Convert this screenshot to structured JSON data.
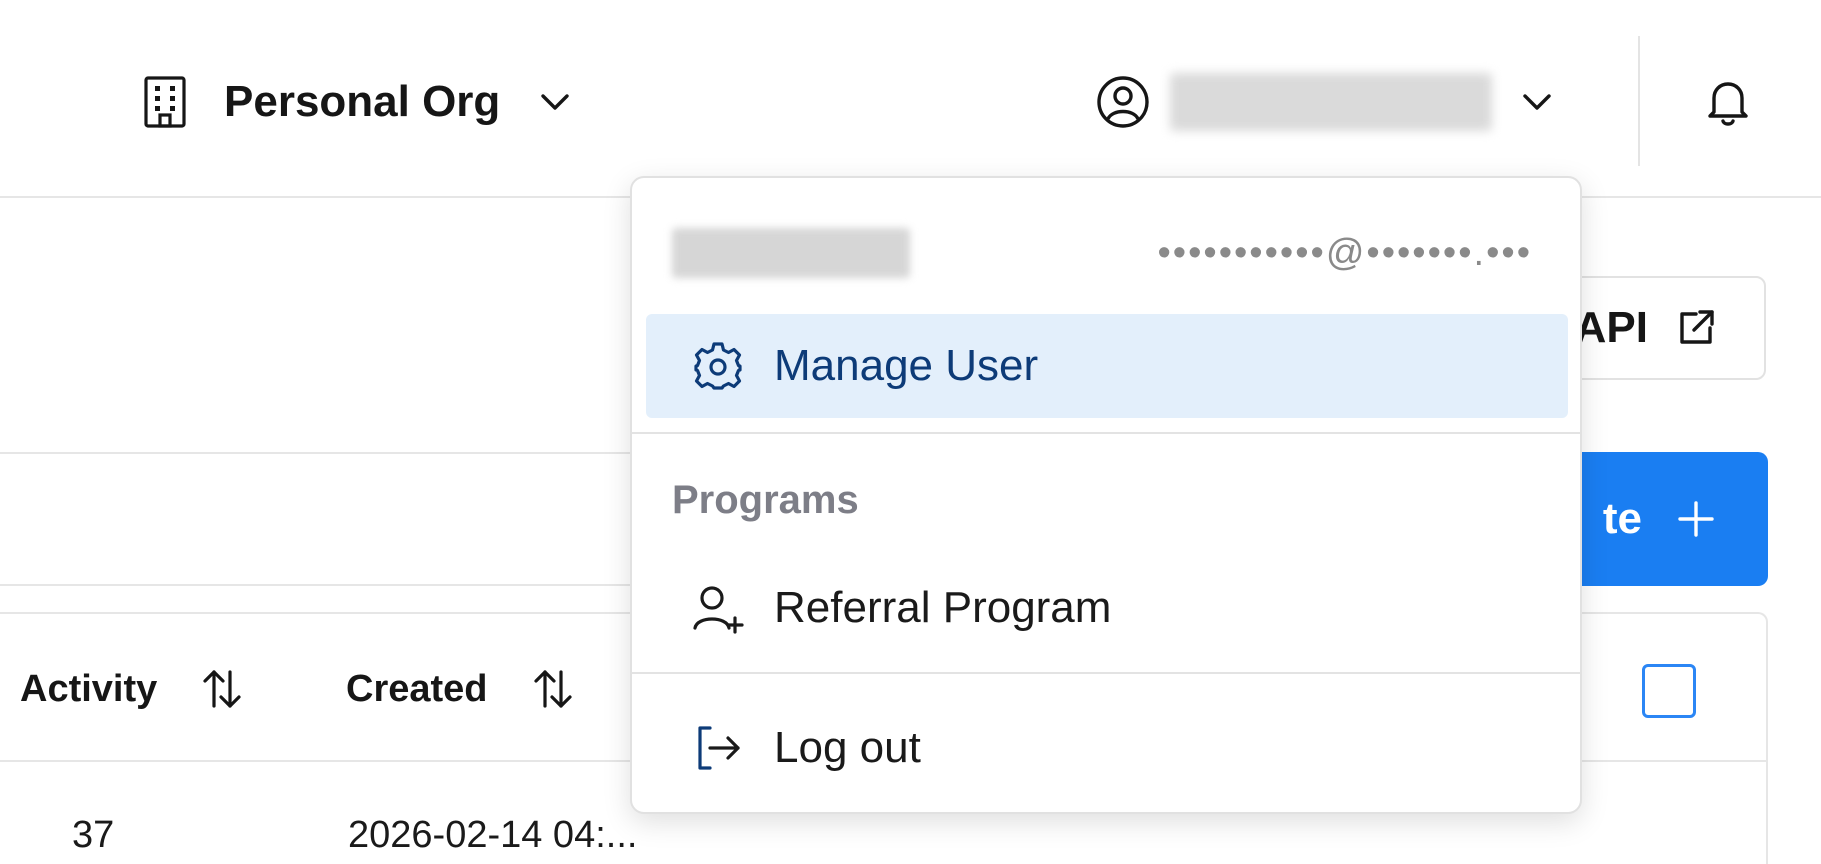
{
  "header": {
    "org_name": "Personal Org",
    "org_icon": "building-icon",
    "user_icon": "user-circle-icon",
    "notifications_icon": "bell-icon"
  },
  "background": {
    "api_button_label": "API",
    "create_button_label": "te",
    "table": {
      "columns": [
        "Activity",
        "Created"
      ],
      "rows": [
        {
          "activity": "37",
          "created": "2026-02-14 04:..."
        }
      ]
    }
  },
  "dropdown": {
    "email": "•••••••••••@•••••••.•••",
    "manage_user_label": "Manage User",
    "section_programs": "Programs",
    "referral_label": "Referral Program",
    "logout_label": "Log out"
  },
  "colors": {
    "accent": "#1a7ef2",
    "active_bg": "#e3effb",
    "active_text": "#0d3b78"
  }
}
